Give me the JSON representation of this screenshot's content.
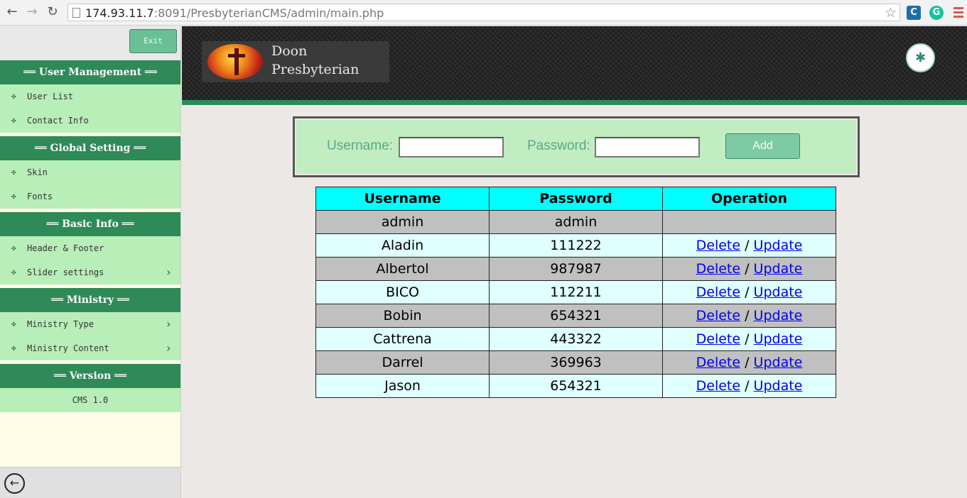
{
  "browser": {
    "url_host": "174.93.11.7",
    "url_rest": ":8091/PresbyterianCMS/admin/main.php",
    "icons": {
      "back": "back-arrow-icon",
      "forward": "forward-arrow-icon",
      "reload": "reload-icon",
      "bookmark": "star-icon",
      "menu": "hamburger-menu-icon"
    }
  },
  "sidebar": {
    "exit_label": "Exit",
    "sections": [
      {
        "title": "══ User Management ══",
        "items": [
          {
            "label": "User List"
          },
          {
            "label": "Contact Info"
          }
        ]
      },
      {
        "title": "══ Global Setting ══",
        "items": [
          {
            "label": "Skin"
          },
          {
            "label": "Fonts"
          }
        ]
      },
      {
        "title": "══ Basic Info ══",
        "items": [
          {
            "label": "Header & Footer"
          },
          {
            "label": "Slider settings",
            "has_submenu": true
          }
        ]
      },
      {
        "title": "══ Ministry ══",
        "items": [
          {
            "label": "Ministry Type",
            "has_submenu": true
          },
          {
            "label": "Ministry Content",
            "has_submenu": true
          }
        ]
      },
      {
        "title": "══ Version ══",
        "text": "CMS 1.0"
      }
    ],
    "bullet": "✣",
    "chevron": "›",
    "back_icon": "←"
  },
  "header": {
    "logo_line1": "Doon",
    "logo_line2": "Presbyterian",
    "magic_icon": "✱",
    "colors": {
      "accent": "#2e8a57",
      "header_bg": "#262626"
    }
  },
  "form": {
    "username_label": "Username:",
    "password_label": "Password:",
    "username_value": "",
    "password_value": "",
    "add_label": "Add"
  },
  "table": {
    "headers": [
      "Username",
      "Password",
      "Operation"
    ],
    "rows": [
      {
        "username": "admin",
        "password": "admin",
        "ops": false
      },
      {
        "username": "Aladin",
        "password": "111222",
        "ops": true
      },
      {
        "username": "Albertol",
        "password": "987987",
        "ops": true
      },
      {
        "username": "BICO",
        "password": "112211",
        "ops": true
      },
      {
        "username": "Bobin",
        "password": "654321",
        "ops": true
      },
      {
        "username": "Cattrena",
        "password": "443322",
        "ops": true
      },
      {
        "username": "Darrel",
        "password": "369963",
        "ops": true
      },
      {
        "username": "Jason",
        "password": "654321",
        "ops": true
      }
    ],
    "delete_label": "Delete",
    "separator": " / ",
    "update_label": "Update",
    "colors": {
      "header_bg": "#00ffff",
      "row_gray": "#c0c0c0",
      "row_cyan": "#e0ffff",
      "link": "#0000ee"
    }
  }
}
